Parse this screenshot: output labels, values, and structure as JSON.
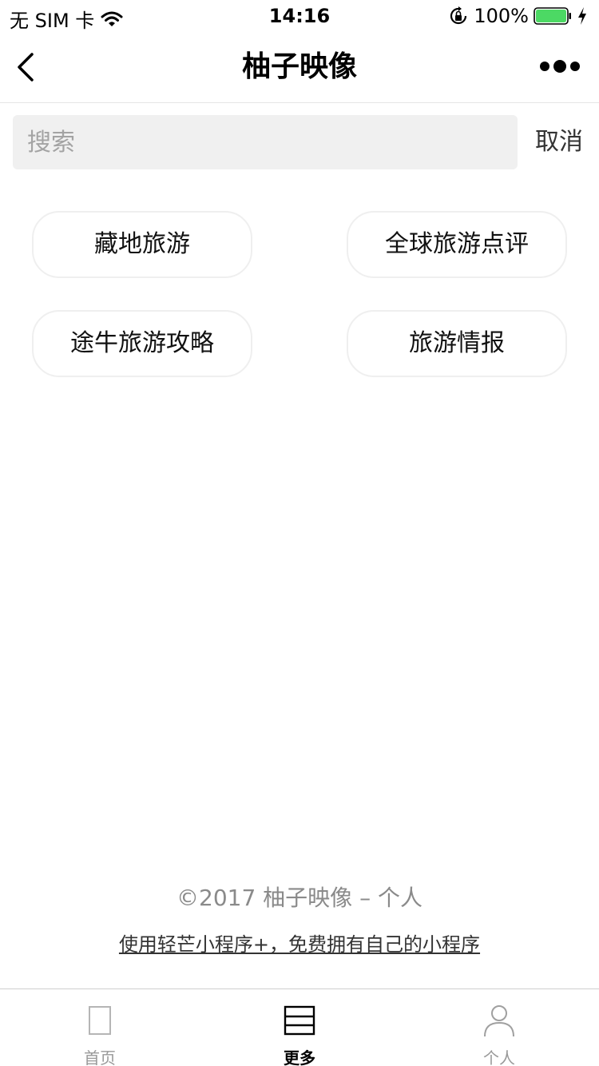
{
  "status_bar": {
    "carrier": "无 SIM 卡",
    "time": "14:16",
    "battery_percent": "100%",
    "battery_level": 1.0,
    "battery_color": "#4cd964"
  },
  "nav": {
    "title": "柚子映像"
  },
  "search": {
    "placeholder": "搜索",
    "value": "",
    "cancel_label": "取消"
  },
  "tags": [
    {
      "label": "藏地旅游"
    },
    {
      "label": "全球旅游点评"
    },
    {
      "label": "途牛旅游攻略"
    },
    {
      "label": "旅游情报"
    }
  ],
  "footer": {
    "copyright": "©2017 柚子映像 – 个人",
    "promo": "使用轻芒小程序+，免费拥有自己的小程序"
  },
  "tab_bar": {
    "items": [
      {
        "label": "首页",
        "icon": "page-icon",
        "active": false
      },
      {
        "label": "更多",
        "icon": "list-icon",
        "active": true
      },
      {
        "label": "个人",
        "icon": "person-icon",
        "active": false
      }
    ],
    "active_color": "#000000",
    "inactive_color": "#999999"
  }
}
